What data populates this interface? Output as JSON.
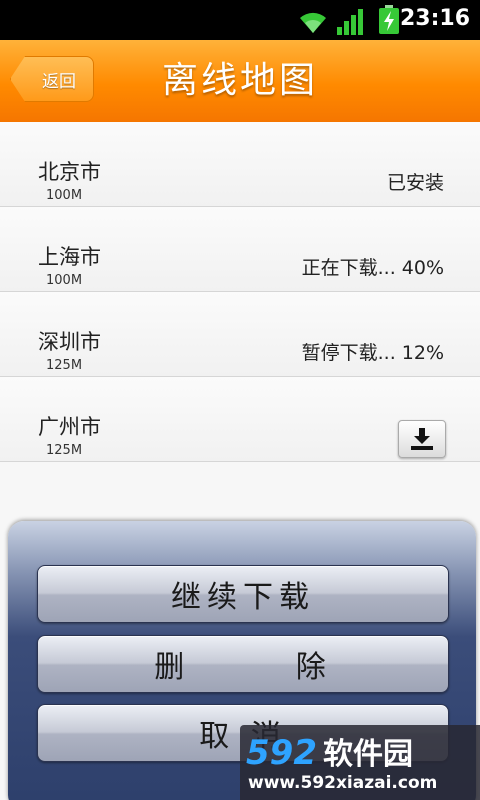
{
  "status_bar": {
    "time": "23:16",
    "icons": [
      "wifi-icon",
      "signal-icon",
      "battery-charging-icon"
    ]
  },
  "header": {
    "back_label": "返回",
    "title": "离线地图"
  },
  "cities": [
    {
      "name": "北京市",
      "size": "100M",
      "status": "已安装"
    },
    {
      "name": "上海市",
      "size": "100M",
      "status": "正在下载... 40%"
    },
    {
      "name": "深圳市",
      "size": "125M",
      "status": "暂停下载... 12%"
    },
    {
      "name": "广州市",
      "size": "125M",
      "status": ""
    }
  ],
  "action_sheet": {
    "continue_label": "继续下载",
    "delete_label": "删 除",
    "cancel_label": "取 消"
  },
  "watermark": {
    "brand_number": "592",
    "brand_text": "软件园",
    "url": "www.592xiazai.com"
  },
  "colors": {
    "accent": "#ff8a00",
    "sheet": "#2d3f6b"
  }
}
